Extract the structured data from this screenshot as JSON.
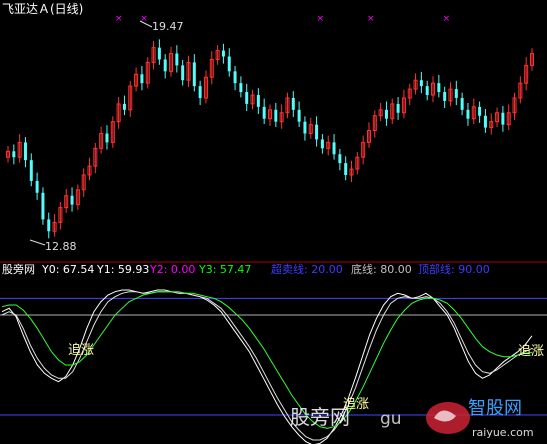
{
  "title_bar": {
    "title": "飞亚达Ａ(日线)"
  },
  "price_panel": {
    "high_label": "19.47",
    "low_label": "12.88",
    "colors": {
      "up": "#ff3232",
      "down": "#54fcfc",
      "marker": "#ff00ff"
    }
  },
  "indicator_header": {
    "name": "股旁网",
    "items": [
      {
        "label": "Y0:",
        "value": "67.54",
        "color": "#ffffff"
      },
      {
        "label": "Y1:",
        "value": "59.93",
        "color": "#ffffff"
      },
      {
        "label": "Y2:",
        "value": "0.00",
        "color": "#ff00ff"
      },
      {
        "label": "Y3:",
        "value": "57.47",
        "color": "#00ff00"
      },
      {
        "label": "超卖线:",
        "value": "20.00",
        "color": "#3c3cff"
      },
      {
        "label": "底线:",
        "value": "80.00",
        "color": "#c0c0c0"
      },
      {
        "label": "顶部线:",
        "value": "90.00",
        "color": "#3c3cff"
      }
    ]
  },
  "annotations": [
    {
      "text": "追涨",
      "color": "#ffffa0"
    },
    {
      "text": "追涨",
      "color": "#ffffa0"
    },
    {
      "text": "追涨",
      "color": "#ffffa0"
    }
  ],
  "watermark": {
    "left_text": "股旁网",
    "mid_text": "gu",
    "right_text": "智股网",
    "url": "raiyue.com"
  },
  "chart_data": [
    {
      "type": "candlestick",
      "title": "飞亚达Ａ(日线)",
      "annotations": {
        "max": 19.47,
        "min": 12.88
      },
      "ylim": [
        12.2,
        20.1
      ],
      "closes": [
        15.6,
        15.4,
        15.9,
        15.3,
        14.6,
        14.2,
        13.3,
        12.9,
        13.2,
        13.7,
        14.1,
        13.8,
        14.3,
        14.8,
        15.1,
        15.7,
        16.2,
        15.9,
        16.6,
        17.2,
        17.0,
        17.8,
        18.2,
        17.9,
        18.6,
        19.1,
        18.7,
        18.3,
        18.9,
        18.5,
        18.0,
        18.6,
        17.8,
        17.4,
        18.1,
        18.7,
        19.0,
        18.8,
        18.3,
        17.9,
        17.6,
        17.2,
        17.5,
        17.1,
        16.7,
        17.0,
        16.6,
        16.9,
        17.4,
        17.0,
        16.6,
        16.2,
        16.5,
        16.0,
        15.7,
        15.9,
        15.5,
        15.2,
        14.8,
        15.0,
        15.4,
        15.9,
        16.3,
        16.8,
        17.0,
        16.7,
        17.2,
        16.9,
        17.4,
        17.7,
        18.0,
        17.8,
        17.5,
        17.9,
        17.6,
        17.3,
        17.7,
        17.4,
        17.0,
        16.7,
        17.1,
        16.8,
        16.4,
        16.6,
        16.9,
        16.5,
        16.9,
        17.4,
        17.9,
        18.5,
        18.9
      ]
    },
    {
      "type": "line",
      "series": [
        {
          "name": "Y0",
          "values": [
            82,
            84,
            79,
            68,
            58,
            50,
            45,
            42,
            40,
            43,
            50,
            60,
            72,
            82,
            88,
            92,
            94,
            95,
            95,
            94,
            93,
            94,
            95,
            95,
            94,
            93,
            93,
            92,
            91,
            89,
            86,
            82,
            76,
            70,
            64,
            58,
            50,
            42,
            34,
            26,
            19,
            13,
            8,
            4,
            2,
            3,
            6,
            12,
            20,
            30,
            42,
            55,
            68,
            78,
            86,
            91,
            93,
            92,
            90,
            91,
            93,
            90,
            85,
            80,
            72,
            62,
            52,
            45,
            42,
            44,
            48,
            52,
            55,
            58,
            62,
            67.54
          ]
        },
        {
          "name": "Y1",
          "values": [
            80,
            82,
            80,
            72,
            62,
            54,
            48,
            44,
            42,
            42,
            46,
            54,
            64,
            74,
            82,
            88,
            91,
            93,
            94,
            94,
            93,
            93,
            94,
            94,
            94,
            93,
            93,
            92,
            91,
            90,
            87,
            84,
            79,
            73,
            67,
            61,
            54,
            46,
            38,
            30,
            23,
            16,
            11,
            7,
            5,
            5,
            7,
            11,
            17,
            26,
            36,
            48,
            60,
            71,
            80,
            87,
            90,
            91,
            90,
            90,
            91,
            90,
            87,
            82,
            75,
            66,
            57,
            50,
            46,
            45,
            47,
            50,
            53,
            56,
            58,
            59.93
          ]
        },
        {
          "name": "Y3",
          "values": [
            85,
            86,
            86,
            83,
            78,
            72,
            65,
            58,
            53,
            50,
            50,
            52,
            56,
            62,
            68,
            74,
            80,
            84,
            88,
            90,
            92,
            93,
            94,
            94,
            94,
            94,
            93,
            93,
            92,
            91,
            90,
            88,
            85,
            81,
            77,
            72,
            66,
            60,
            53,
            46,
            39,
            32,
            26,
            20,
            16,
            13,
            12,
            13,
            16,
            21,
            28,
            36,
            45,
            54,
            63,
            71,
            78,
            83,
            87,
            89,
            90,
            90,
            89,
            87,
            83,
            78,
            72,
            66,
            61,
            58,
            56,
            55,
            55,
            56,
            57,
            57.47
          ]
        }
      ],
      "reference_lines": {
        "超卖线": 20,
        "底线": 80,
        "顶部线": 90
      },
      "ylim": [
        5,
        101
      ]
    }
  ]
}
